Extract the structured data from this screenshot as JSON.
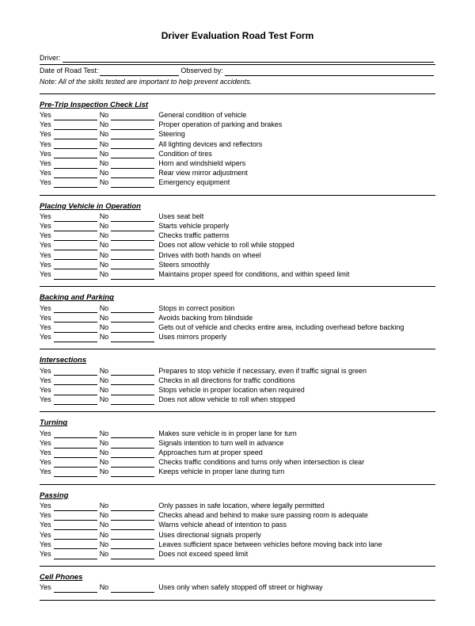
{
  "title": "Driver Evaluation Road Test Form",
  "fields": {
    "driver_label": "Driver:",
    "date_label": "Date of Road Test:",
    "observed_label": "Observed by:"
  },
  "note": "Note:  All of the skills tested are important to help prevent accidents.",
  "labels": {
    "yes": "Yes",
    "no": "No"
  },
  "sections": [
    {
      "heading": "Pre-Trip Inspection Check List",
      "items": [
        "General condition of vehicle",
        "Proper operation of parking and brakes",
        "Steering",
        "All lighting devices and reflectors",
        "Condition of tires",
        "Horn and windshield wipers",
        "Rear view mirror adjustment",
        "Emergency equipment"
      ]
    },
    {
      "heading": "Placing Vehicle in Operation",
      "items": [
        "Uses seat belt",
        "Starts vehicle properly",
        "Checks traffic patterns",
        "Does not allow vehicle to roll while stopped",
        "Drives with both hands on wheel",
        "Steers smoothly",
        "Maintains proper speed for conditions, and within speed limit"
      ]
    },
    {
      "heading": "Backing and Parking",
      "items": [
        "Stops in correct position",
        "Avoids backing from blindside",
        "Gets out of vehicle and checks entire area, including overhead before backing",
        "Uses mirrors properly"
      ]
    },
    {
      "heading": "Intersections",
      "items": [
        "Prepares to stop vehicle if necessary, even if traffic signal is green",
        "Checks in all directions for traffic conditions",
        "Stops vehicle in proper location when required",
        "Does not allow vehicle to roll when stopped"
      ]
    },
    {
      "heading": "Turning",
      "items": [
        "Makes sure vehicle is in proper lane for turn",
        "Signals intention to turn well in advance",
        "Approaches turn at proper speed",
        "Checks traffic conditions and turns only when intersection is clear",
        "Keeps vehicle in proper lane during turn"
      ]
    },
    {
      "heading": "Passing",
      "items": [
        "Only passes in safe location, where legally permitted",
        "Checks ahead and behind to make sure passing room is adequate",
        "Warns vehicle ahead of intention to pass",
        "Uses directional signals properly",
        "Leaves sufficient space between vehicles before moving back into lane",
        "Does not exceed speed limit"
      ]
    },
    {
      "heading": "Cell Phones",
      "items": [
        "Uses only when safely stopped off street or highway"
      ]
    }
  ]
}
